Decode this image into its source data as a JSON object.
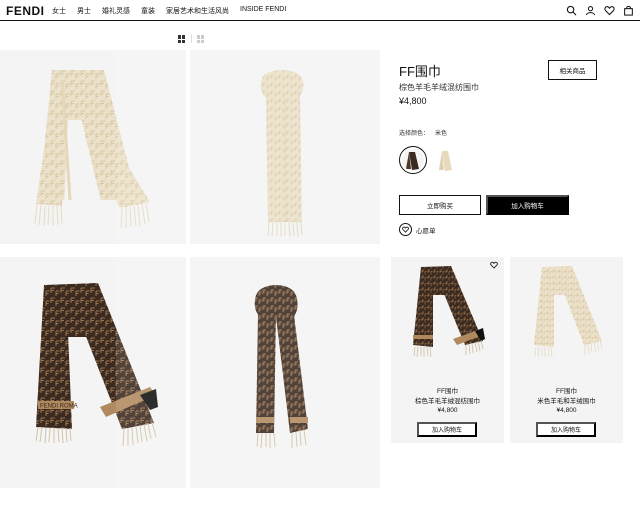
{
  "header": {
    "logo": "FENDI",
    "nav": [
      "女士",
      "男士",
      "婚礼灵感",
      "童装",
      "家居艺术和生活风尚",
      "INSIDE FENDI"
    ]
  },
  "product": {
    "title": "FF围巾",
    "subtitle": "棕色羊毛羊绒混纺围巾",
    "price": "¥4,800",
    "related_label": "相关商品",
    "color_label": "选择颜色：",
    "color_value": "米色",
    "buy_now": "立即购买",
    "add_to_cart": "加入购物车",
    "wishlist": "心愿单"
  },
  "related": [
    {
      "name": "FF围巾",
      "desc": "棕色羊毛羊绒混纺围巾",
      "price": "¥4,800",
      "button": "加入购物车"
    },
    {
      "name": "FF围巾",
      "desc": "米色羊毛和羊绒围巾",
      "price": "¥4,800",
      "button": "加入购物车"
    }
  ],
  "colors": {
    "beige": "#e9ddc3",
    "beige_dark": "#d8c7a4",
    "brown": "#3b2a1f",
    "tan": "#b08a5e",
    "tile_bg": "#f4f4f4"
  }
}
